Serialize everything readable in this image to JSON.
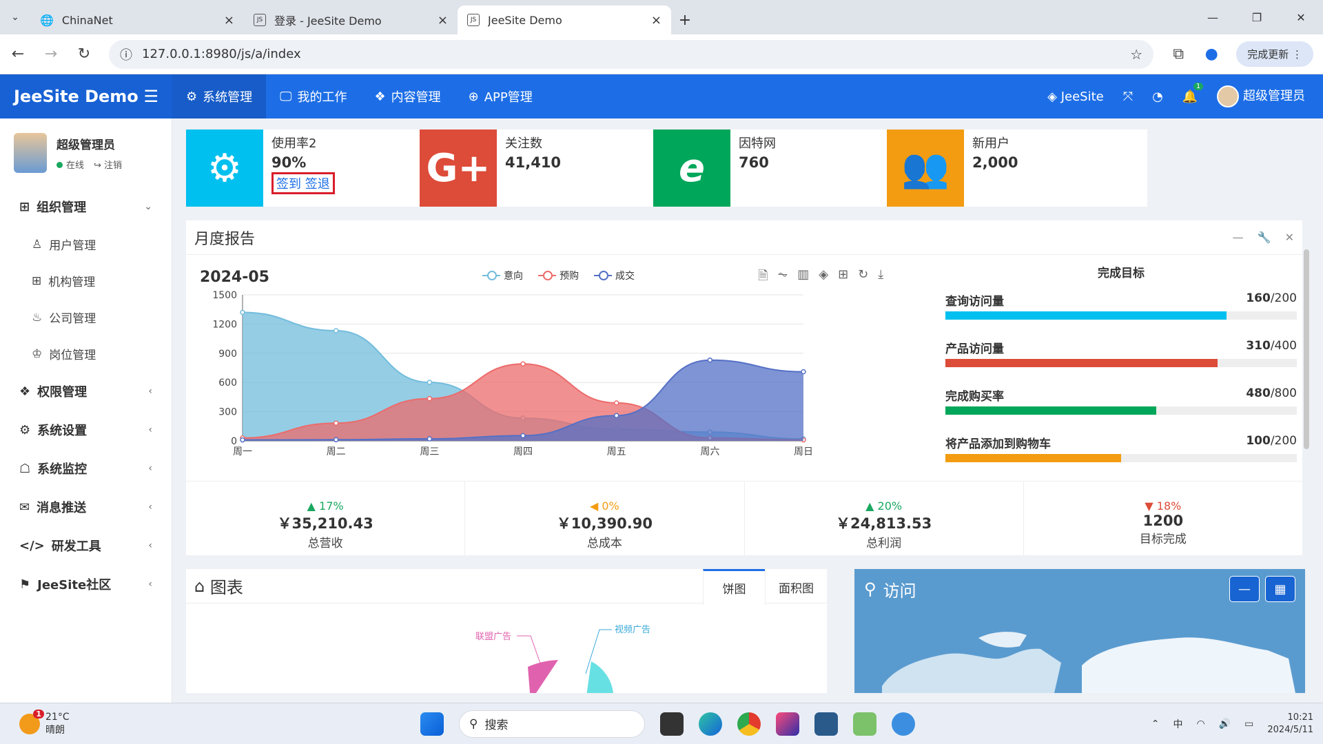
{
  "browser": {
    "tabs": [
      {
        "title": "ChinaNet"
      },
      {
        "title": "登录 - JeeSite Demo"
      },
      {
        "title": "JeeSite Demo"
      }
    ],
    "url": "127.0.0.1:8980/js/a/index",
    "update_label": "完成更新"
  },
  "topnav": {
    "brand": "JeeSite Demo",
    "items": [
      "系统管理",
      "我的工作",
      "内容管理",
      "APP管理"
    ],
    "right_link": "JeeSite",
    "badge": "1",
    "user": "超级管理员"
  },
  "sidebar": {
    "user_name": "超级管理员",
    "online": "在线",
    "logout": "注销",
    "groups": [
      {
        "label": "组织管理",
        "icon": "grid-icon"
      },
      {
        "label": "权限管理",
        "icon": "cubes-icon"
      },
      {
        "label": "系统设置",
        "icon": "gear-icon"
      },
      {
        "label": "系统监控",
        "icon": "monitor-icon"
      },
      {
        "label": "消息推送",
        "icon": "inbox-icon"
      },
      {
        "label": "研发工具",
        "icon": "code-icon"
      },
      {
        "label": "JeeSite社区",
        "icon": "sign-icon"
      }
    ],
    "subitems": [
      "用户管理",
      "机构管理",
      "公司管理",
      "岗位管理"
    ]
  },
  "cards": [
    {
      "label": "使用率2",
      "value": "90%",
      "link1": "签到",
      "link2": "签退",
      "color": "#00c0ef"
    },
    {
      "label": "关注数",
      "value": "41,410",
      "color": "#dd4b39"
    },
    {
      "label": "因特网",
      "value": "760",
      "color": "#00a65a"
    },
    {
      "label": "新用户",
      "value": "2,000",
      "color": "#f39c12"
    }
  ],
  "report": {
    "title": "月度报告",
    "date": "2024-05",
    "goals_title": "完成目标",
    "goals": [
      {
        "label": "查询访问量",
        "value": "160",
        "total": "/200",
        "pct": 0.8,
        "color": "#00c0ef"
      },
      {
        "label": "产品访问量",
        "value": "310",
        "total": "/400",
        "pct": 0.775,
        "color": "#dd4b39"
      },
      {
        "label": "完成购买率",
        "value": "480",
        "total": "/800",
        "pct": 0.6,
        "color": "#00a65a"
      },
      {
        "label": "将产品添加到购物车",
        "value": "100",
        "total": "/200",
        "pct": 0.5,
        "color": "#f39c12"
      }
    ],
    "stats": [
      {
        "pct": "17%",
        "dir": "▲",
        "color": "#1aa760",
        "value": "￥35,210.43",
        "label": "总营收"
      },
      {
        "pct": "0%",
        "dir": "◀",
        "color": "#f39c12",
        "value": "￥10,390.90",
        "label": "总成本"
      },
      {
        "pct": "20%",
        "dir": "▲",
        "color": "#1aa760",
        "value": "￥24,813.53",
        "label": "总利润"
      },
      {
        "pct": "18%",
        "dir": "▼",
        "color": "#dd4b39",
        "value": "1200",
        "label": "目标完成"
      }
    ]
  },
  "chart_data": {
    "type": "area",
    "categories": [
      "周一",
      "周二",
      "周三",
      "周四",
      "周五",
      "周六",
      "周日"
    ],
    "ylim": [
      0,
      1500
    ],
    "yticks": [
      0,
      300,
      600,
      900,
      1200,
      1500
    ],
    "series": [
      {
        "name": "意向",
        "color": "#72bcdc",
        "values": [
          1320,
          1132,
          601,
          234,
          120,
          90,
          20
        ]
      },
      {
        "name": "预购",
        "color": "#ec6b6b",
        "values": [
          30,
          182,
          434,
          791,
          390,
          30,
          10
        ]
      },
      {
        "name": "成交",
        "color": "#5470c6",
        "values": [
          10,
          12,
          21,
          54,
          260,
          830,
          710
        ]
      }
    ]
  },
  "chartpanel": {
    "title": "图表",
    "tabs": [
      "饼图",
      "面积图"
    ],
    "pie_labels": [
      "联盟广告",
      "视频广告"
    ]
  },
  "visit": {
    "title": "访问"
  },
  "taskbar": {
    "temp": "21°C",
    "weather": "晴朗",
    "badge": "1",
    "search": "搜索",
    "ime": "中",
    "time": "10:21",
    "date": "2024/5/11"
  }
}
